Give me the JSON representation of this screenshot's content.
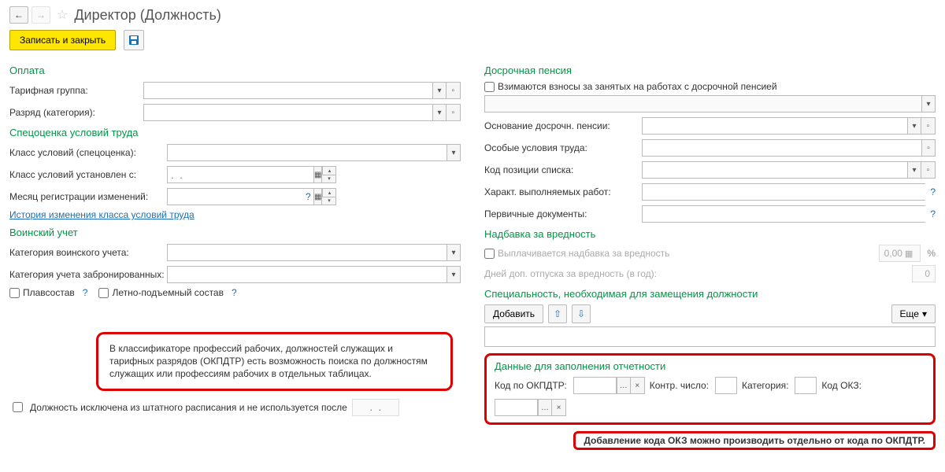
{
  "header": {
    "title": "Директор (Должность)"
  },
  "actions": {
    "save_close": "Записать и закрыть"
  },
  "left": {
    "pay_title": "Оплата",
    "tarif_group": "Тарифная группа:",
    "razryad": "Разряд (категория):",
    "spec_title": "Спецоценка условий труда",
    "class_spec": "Класс условий (спецоценка):",
    "class_set": "Класс условий установлен с:",
    "month_reg": "Месяц регистрации изменений:",
    "date_placeholder": ".  .",
    "history_link": "История изменения класса условий труда",
    "army_title": "Воинский учет",
    "army_cat": "Категория воинского учета:",
    "army_booked": "Категория учета забронированных:",
    "plavsostav": "Плавсостав",
    "letno": "Летно-подъемный состав",
    "annot1": "В классификаторе профессий рабочих, должностей служащих и тарифных разрядов (ОКПДТР) есть возможность поиска по должностям служащих или профессиям рабочих в отдельных таблицах.",
    "excluded": "Должность исключена из штатного расписания и не используется после",
    "excluded_date": ".  ."
  },
  "right": {
    "pension_title": "Досрочная пенсия",
    "pension_check": "Взимаются взносы за занятых на работах с досрочной пенсией",
    "osn_pens": "Основание досрочн. пенсии:",
    "osob_usl": "Особые условия труда:",
    "kod_poz": "Код позиции списка:",
    "har_rabot": "Характ. выполняемых работ:",
    "perv_doc": "Первичные документы:",
    "harm_title": "Надбавка за вредность",
    "harm_check": "Выплачивается надбавка за вредность",
    "harm_value": "0,00",
    "vac_days": "Дней доп. отпуска за вредность (в год):",
    "vac_value": "0",
    "spec_need_title": "Специальность, необходимая для замещения должности",
    "add_btn": "Добавить",
    "more_btn": "Еще",
    "report_title": "Данные для заполнения отчетности",
    "okpdtr": "Код по ОКПДТР:",
    "kontr": "Контр. число:",
    "categ": "Категория:",
    "okz": "Код ОКЗ:",
    "annot2": "Добавление кода ОКЗ можно производить отдельно от кода по ОКПДТР."
  }
}
